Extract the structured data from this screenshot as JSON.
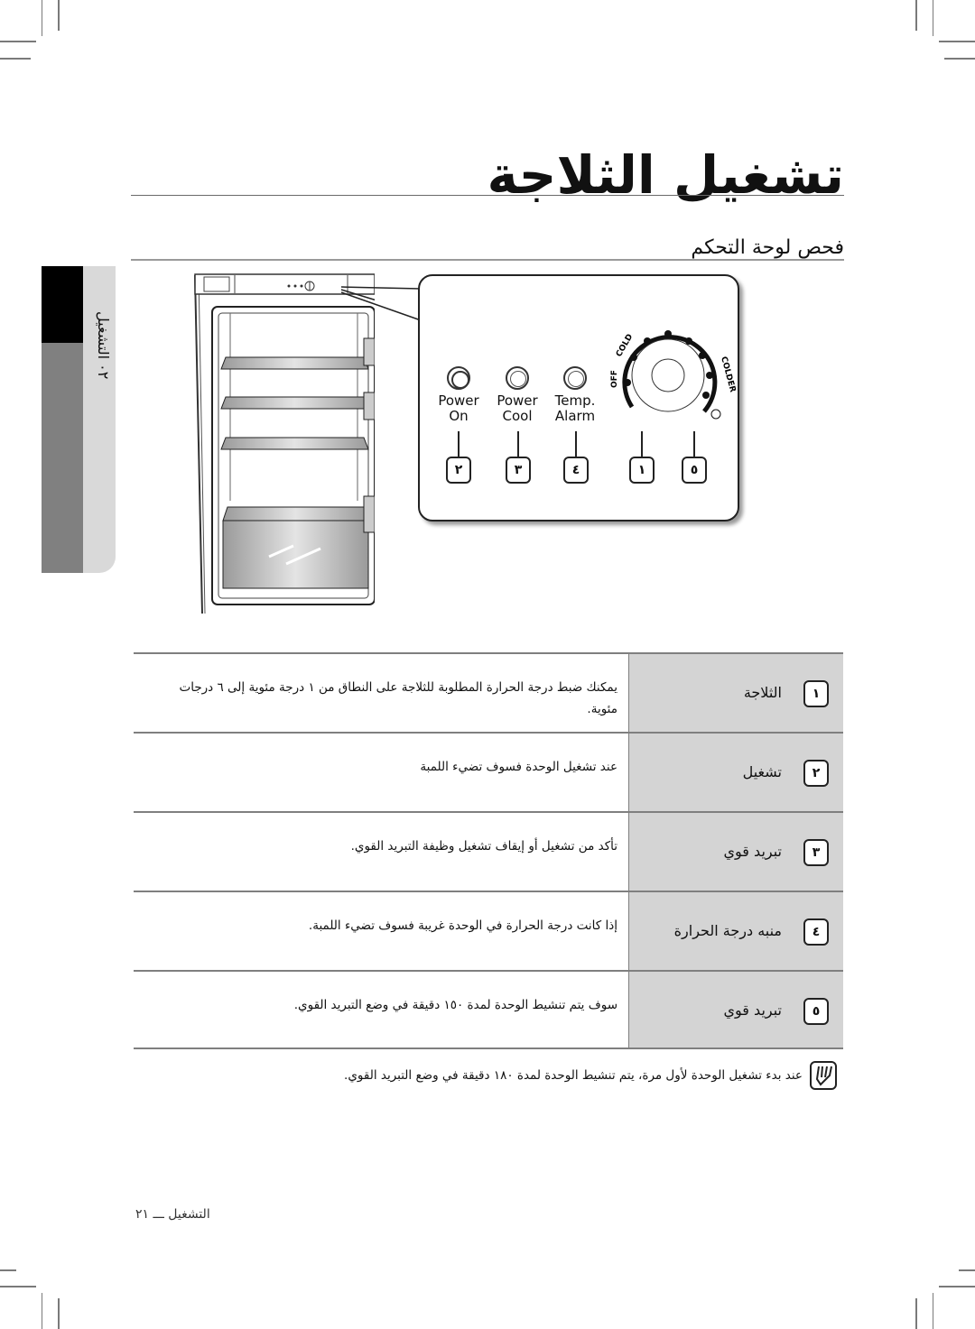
{
  "page": {
    "title": "تشغيل الثلاجة",
    "subtitle": "فحص لوحة التحكم",
    "side_tab": "٠٢ التشغيل",
    "footer": "التشغيل ـــ ٢١"
  },
  "control_panel": {
    "indicators": [
      {
        "label_line1": "Power",
        "label_line2": "On",
        "number": "٢",
        "state": "on"
      },
      {
        "label_line1": "Power",
        "label_line2": "Cool",
        "number": "٣",
        "state": "off"
      },
      {
        "label_line1": "Temp.",
        "label_line2": "Alarm",
        "number": "٤",
        "state": "off"
      }
    ],
    "dial": {
      "labels": {
        "off": "OFF",
        "cold": "COLD",
        "colder": "COLDER"
      },
      "number": "١",
      "extra_number": "٥",
      "extra_icon": "snowflake-drop-icon"
    }
  },
  "table": {
    "rows": [
      {
        "number": "١",
        "label": "الثلاجة",
        "description": "يمكنك ضبط درجة الحرارة المطلوبة للثلاجة على النطاق من ١ درجة مئوية إلى ٦ درجات مئوية."
      },
      {
        "number": "٢",
        "label": "تشغيل",
        "description": "عند تشغيل الوحدة فسوف تضيء اللمبة"
      },
      {
        "number": "٣",
        "label": "تبريد قوي",
        "description": "تأكد من تشغيل أو إيقاف تشغيل وظيفة التبريد القوي."
      },
      {
        "number": "٤",
        "label": "منبه درجة الحرارة",
        "description": "إذا كانت درجة الحرارة في الوحدة غريبة فسوف تضيء اللمبة."
      },
      {
        "number": "٥",
        "label": "تبريد قوي",
        "description": "سوف يتم تنشيط الوحدة لمدة ١٥٠ دقيقة في وضع التبريد القوي."
      }
    ]
  },
  "note": {
    "icon": "note-pencil-icon",
    "text": "عند بدء تشغيل الوحدة لأول مرة، يتم تنشيط الوحدة لمدة ١٨٠ دقيقة في وضع التبريد القوي."
  }
}
